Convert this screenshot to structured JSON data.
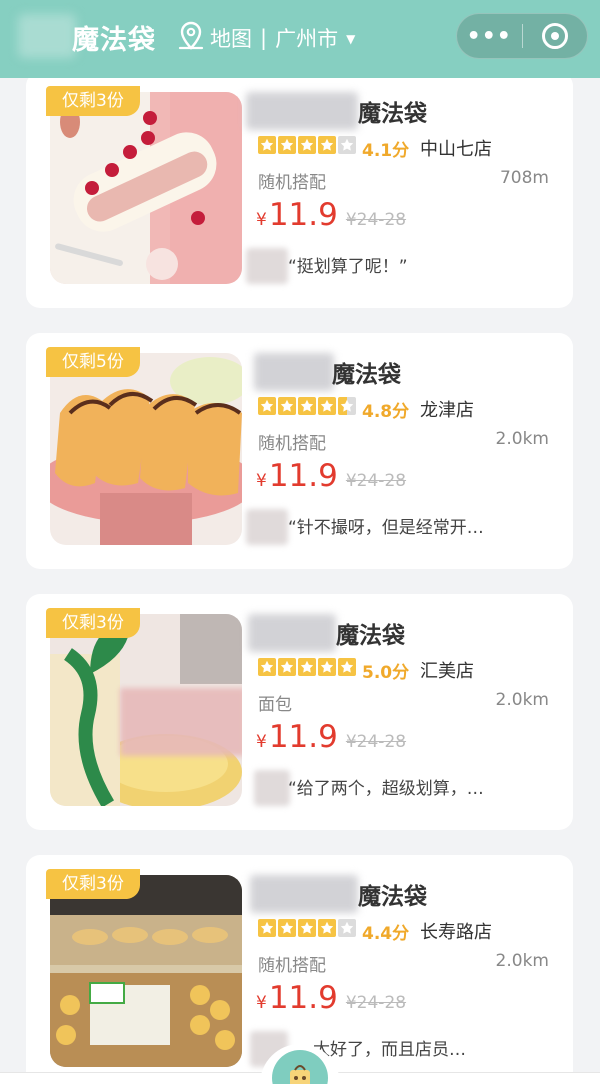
{
  "header": {
    "title": "魔法袋",
    "map_label": "地图",
    "separator": "|",
    "city": "广州市",
    "caret": "▼"
  },
  "capsule": {
    "more": "•••"
  },
  "colors": {
    "header": "#86cfc1",
    "tag": "#f6c343",
    "price": "#e23b2e",
    "star": "#f6c343"
  },
  "cards": [
    {
      "stock_tag": "仅剩3份",
      "name": "魔法袋",
      "stars": [
        1,
        1,
        1,
        1,
        0
      ],
      "rating": "4.1分",
      "store": "中山七店",
      "category": "随机搭配",
      "distance": "708m",
      "yen": "¥",
      "price": "11.9",
      "original_price": "¥24-28",
      "review": "“挺划算了呢！”"
    },
    {
      "stock_tag": "仅剩5份",
      "name": "魔法袋",
      "stars": [
        1,
        1,
        1,
        1,
        0.5
      ],
      "rating": "4.8分",
      "store": "龙津店",
      "category": "随机搭配",
      "distance": "2.0km",
      "yen": "¥",
      "price": "11.9",
      "original_price": "¥24-28",
      "review": "“针不撮呀，但是经常开…"
    },
    {
      "stock_tag": "仅剩3份",
      "name": "魔法袋",
      "stars": [
        1,
        1,
        1,
        1,
        1
      ],
      "rating": "5.0分",
      "store": "汇美店",
      "category": "面包",
      "distance": "2.0km",
      "yen": "¥",
      "price": "11.9",
      "original_price": "¥24-28",
      "review": "“给了两个，超级划算，…"
    },
    {
      "stock_tag": "仅剩3份",
      "name": "魔法袋",
      "stars": [
        1,
        1,
        1,
        1,
        0
      ],
      "rating": "4.4分",
      "store": "长寿路店",
      "category": "随机搭配",
      "distance": "2.0km",
      "yen": "¥",
      "price": "11.9",
      "original_price": "¥24-28",
      "review": "…太好了，而且店员…"
    }
  ]
}
